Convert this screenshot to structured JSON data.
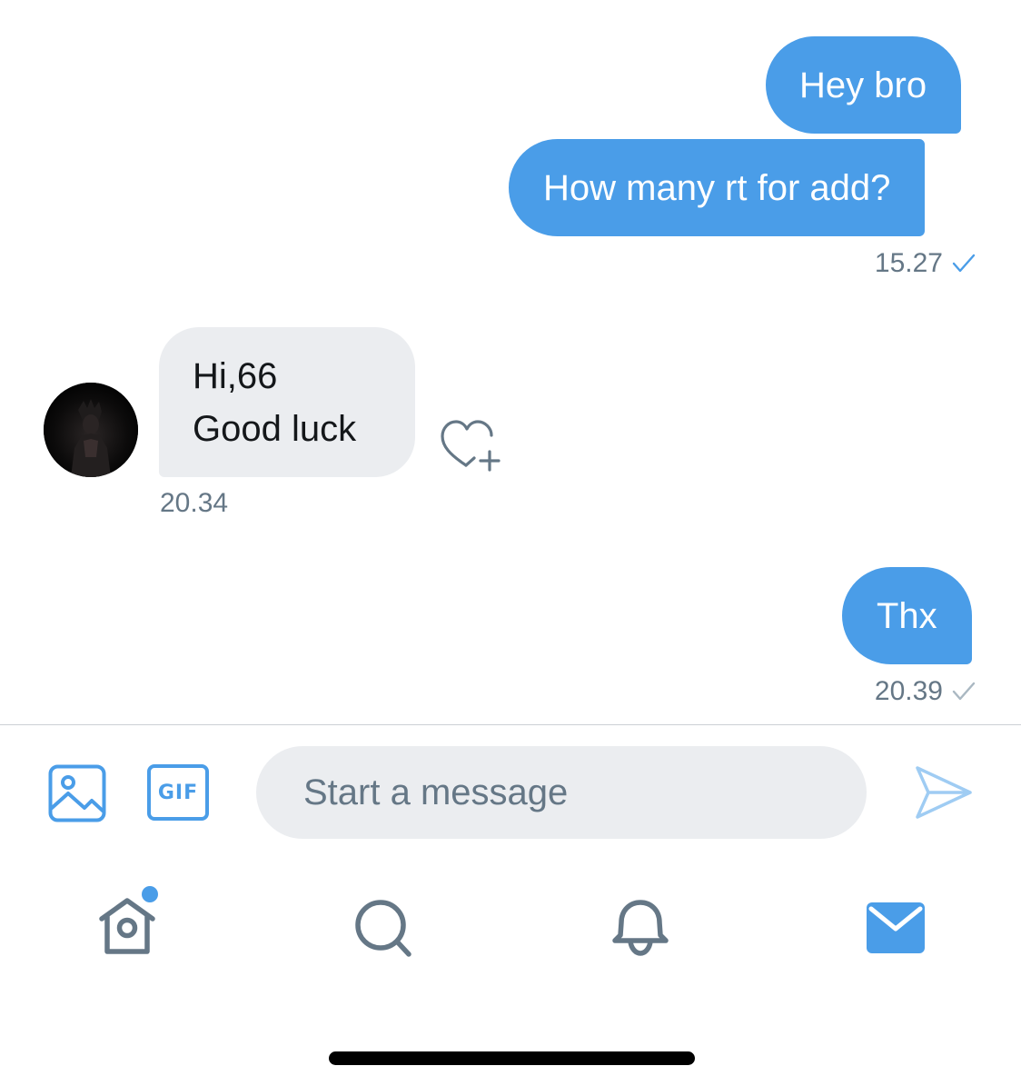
{
  "conversation": {
    "messages": [
      {
        "direction": "outgoing",
        "text": "Hey bro"
      },
      {
        "direction": "outgoing",
        "text": "How many rt for add?",
        "time": "15.27",
        "read": true
      },
      {
        "direction": "incoming",
        "lines": [
          "Hi,66",
          "Good luck"
        ],
        "time": "20.34"
      },
      {
        "direction": "outgoing",
        "text": "Thx",
        "time": "20.39",
        "read": false
      }
    ]
  },
  "composer": {
    "placeholder": "Start a message",
    "gif_label": "GIF",
    "accent_color": "#4a9de8",
    "send_enabled": false
  },
  "tab_bar": {
    "tabs": [
      {
        "icon": "home-icon",
        "has_notification_dot": true
      },
      {
        "icon": "search-icon"
      },
      {
        "icon": "notifications-icon"
      },
      {
        "icon": "messages-icon",
        "active": true
      }
    ]
  },
  "colors": {
    "outgoing_bubble": "#4a9de8",
    "incoming_bubble": "#ebedf0",
    "secondary_text": "#657786",
    "icon_gray": "#657786"
  }
}
